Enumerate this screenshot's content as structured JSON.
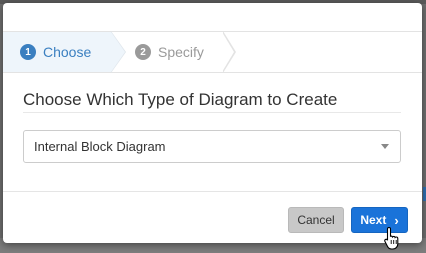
{
  "wizard": {
    "steps": [
      {
        "number": "1",
        "label": "Choose",
        "state": "active"
      },
      {
        "number": "2",
        "label": "Specify",
        "state": "inactive"
      }
    ]
  },
  "main": {
    "heading": "Choose Which Type of Diagram to Create",
    "diagram_type_select": {
      "selected": "Internal Block Diagram"
    }
  },
  "footer": {
    "cancel_label": "Cancel",
    "next_label": "Next",
    "next_icon": "chevron-right-icon"
  },
  "colors": {
    "accent": "#1a73d9",
    "active_step": "#3a7fc0",
    "inactive_step": "#9a9a9a"
  }
}
